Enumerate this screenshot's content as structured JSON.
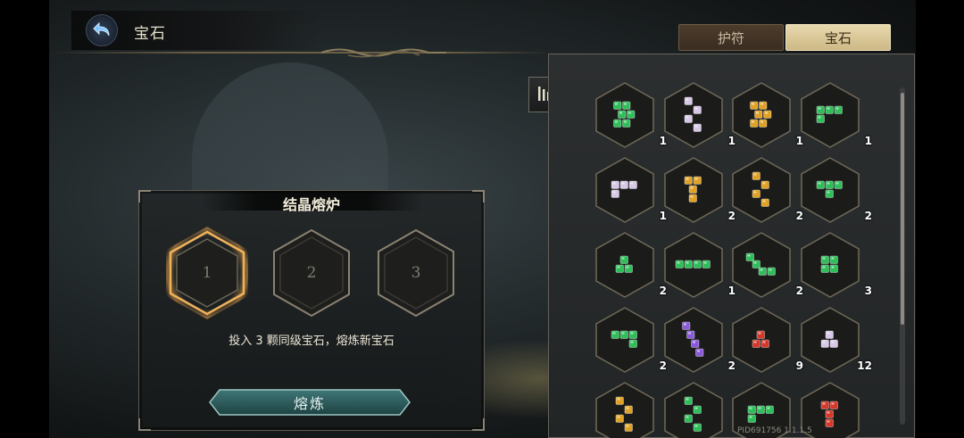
{
  "header": {
    "title": "宝石",
    "back_icon": "back-arrow-icon"
  },
  "tabs": [
    {
      "label": "护符",
      "active": false
    },
    {
      "label": "宝石",
      "active": true
    }
  ],
  "furnace": {
    "title": "结晶熔炉",
    "slots": [
      "1",
      "2",
      "3"
    ],
    "active_slot": 0,
    "hint": "投入 3 颗同级宝石，熔炼新宝石",
    "button_label": "熔炼"
  },
  "filter_icon": "filter-sort-icon",
  "colors": {
    "green": "#2fbf5a",
    "lavender": "#d6c8e6",
    "gold": "#e0a224",
    "purple": "#8a5bd9",
    "red": "#d6392a",
    "tab_active": "#e3d19f",
    "slot_glow": "#e6a24a",
    "button_teal": "#2c5b5c"
  },
  "inventory": {
    "rows": [
      [
        {
          "color": "green",
          "shape": "pyramid",
          "count": "1"
        },
        {
          "color": "lavender",
          "shape": "zigzag",
          "count": "1"
        },
        {
          "color": "gold",
          "shape": "pyramid",
          "count": "1"
        },
        {
          "color": "green",
          "shape": "stairs",
          "count": "1"
        }
      ],
      [
        {
          "color": "lavender",
          "shape": "stairs",
          "count": "1"
        },
        {
          "color": "gold",
          "shape": "tee",
          "count": "2"
        },
        {
          "color": "gold",
          "shape": "zigzag",
          "count": "2"
        },
        {
          "color": "green",
          "shape": "vee",
          "count": "2"
        }
      ],
      [
        {
          "color": "green",
          "shape": "triangle",
          "count": "2"
        },
        {
          "color": "green",
          "shape": "line",
          "count": "1"
        },
        {
          "color": "green",
          "shape": "diag",
          "count": "2"
        },
        {
          "color": "green",
          "shape": "square",
          "count": "3"
        }
      ],
      [
        {
          "color": "green",
          "shape": "hook",
          "count": "2"
        },
        {
          "color": "purple",
          "shape": "diagline",
          "count": "2"
        },
        {
          "color": "red",
          "shape": "triangle",
          "count": "9"
        },
        {
          "color": "lavender",
          "shape": "triangle",
          "count": "12"
        }
      ],
      [
        {
          "color": "gold",
          "shape": "zigzag",
          "count": ""
        },
        {
          "color": "green",
          "shape": "zigzag",
          "count": ""
        },
        {
          "color": "green",
          "shape": "stairs",
          "count": ""
        },
        {
          "color": "red",
          "shape": "tee",
          "count": ""
        }
      ]
    ]
  },
  "footer": {
    "build": "PID691756  1.1.1.5"
  }
}
